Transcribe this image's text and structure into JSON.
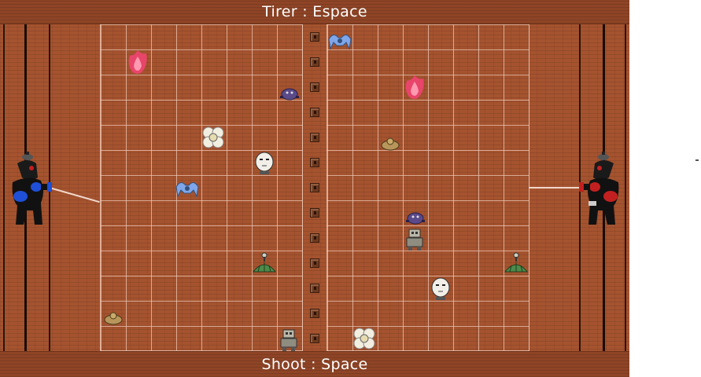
{
  "top_banner": {
    "text": "Tirer : Espace"
  },
  "bottom_banner": {
    "text": "Shoot : Space"
  },
  "colors": {
    "floor": "#a5532f",
    "banner": "#8e4426",
    "grid_line": "#f0c8b4",
    "banner_text": "#ffffff"
  },
  "players": [
    {
      "name": "player-left",
      "icon": "dark-creature-blue-icon",
      "accent": "#1f4fd6"
    },
    {
      "name": "player-right",
      "icon": "dark-creature-red-icon",
      "accent": "#c22020"
    }
  ],
  "creatures": [
    "pink-flame-icon",
    "blue-bird-icon",
    "purple-crab-icon",
    "purple-crab-icon",
    "white-flower-icon",
    "white-mask-icon",
    "tan-beetle-icon",
    "green-plant-icon",
    "robot-icon",
    "white-mask-icon",
    "green-plant-icon",
    "tan-beetle-icon",
    "robot-icon",
    "white-flower-icon",
    "blue-bird-icon",
    "pink-flame-icon"
  ]
}
